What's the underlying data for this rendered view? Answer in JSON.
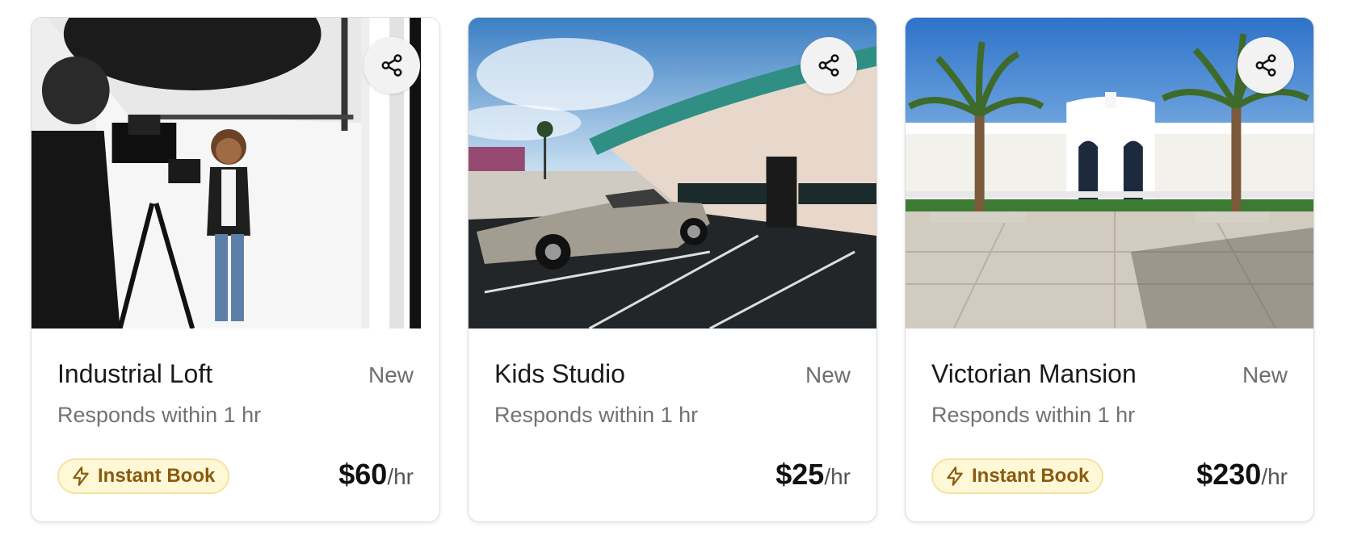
{
  "listings": [
    {
      "title": "Industrial Loft",
      "badge": "New",
      "responds": "Responds within 1 hr",
      "instant_book": "Instant Book",
      "price": "$60",
      "price_unit": "/hr",
      "share_icon": "share-icon"
    },
    {
      "title": "Kids Studio",
      "badge": "New",
      "responds": "Responds within 1 hr",
      "price": "$25",
      "price_unit": "/hr",
      "share_icon": "share-icon"
    },
    {
      "title": "Victorian Mansion",
      "badge": "New",
      "responds": "Responds within 1 hr",
      "instant_book": "Instant Book",
      "price": "$230",
      "price_unit": "/hr",
      "share_icon": "share-icon"
    }
  ],
  "colors": {
    "instant_bg": "#fff8d6",
    "instant_border": "#f4e3a0",
    "instant_text": "#8a5a0f"
  }
}
